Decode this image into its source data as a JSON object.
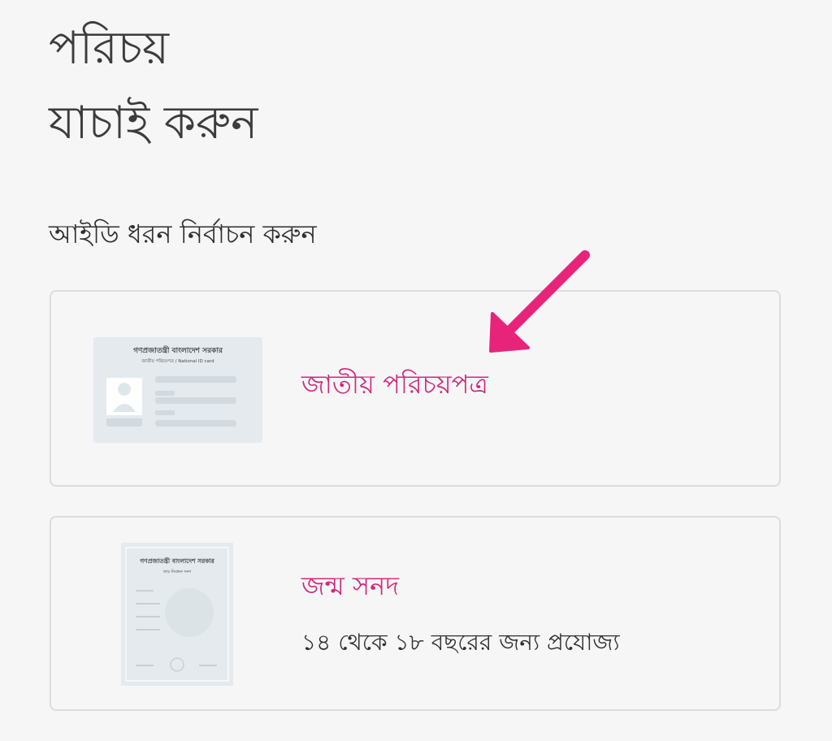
{
  "header": {
    "title_line1": "পরিচয়",
    "title_line2": "যাচাই করুন"
  },
  "subtitle": "আইডি ধরন নির্বাচন করুন",
  "id_options": [
    {
      "label": "জাতীয় পরিচয়পত্র",
      "thumbnail": {
        "heading": "গণপ্রজাতন্ত্রী বাংলাদেশ সরকার",
        "subheading": "জাতীয় পরিচয়পত্র / National ID card"
      }
    },
    {
      "label": "জন্ম সনদ",
      "note": "১৪ থেকে ১৮ বছরের জন্য প্রযোজ্য",
      "thumbnail": {
        "heading": "গণপ্রজাতন্ত্রী বাংলাদেশ সরকার",
        "subheading": "জন্ম নিবন্ধন সনদ"
      }
    }
  ],
  "colors": {
    "accent": "#d0287a",
    "arrow": "#e8247a",
    "background": "#f6f6f7",
    "card_border": "#dcdcdc",
    "text": "#2f2f2f"
  },
  "icons": {
    "pointer": "arrow-down-left-icon",
    "nid_thumbnail": "national-id-card-icon",
    "birth_thumbnail": "birth-certificate-icon"
  }
}
